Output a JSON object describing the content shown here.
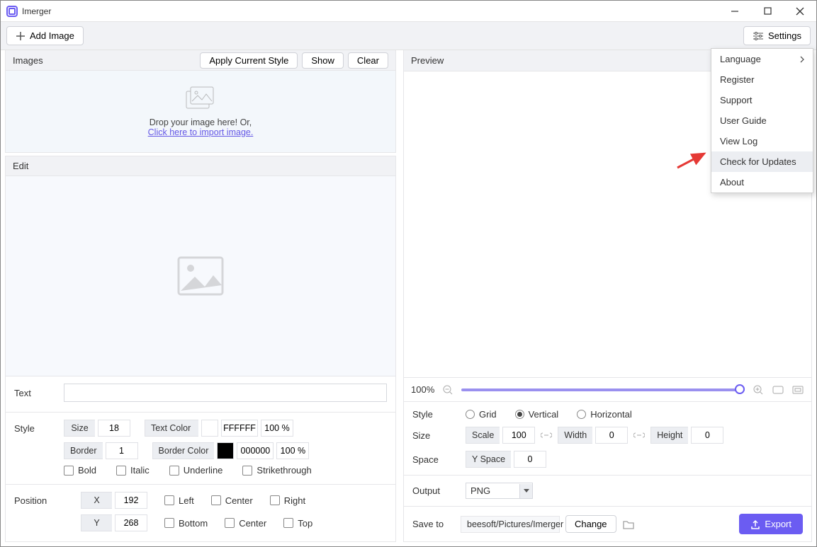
{
  "app": {
    "title": "Imerger"
  },
  "toolbar": {
    "add_image": "Add Image",
    "settings": "Settings"
  },
  "images_panel": {
    "title": "Images",
    "apply_style": "Apply Current Style",
    "show": "Show",
    "clear": "Clear",
    "drop_text": "Drop your image here! Or,",
    "drop_link": "Click here to import image."
  },
  "edit_panel": {
    "title": "Edit"
  },
  "text_section": {
    "label": "Text",
    "value": ""
  },
  "style_section": {
    "label": "Style",
    "size_label": "Size",
    "size_value": "18",
    "border_label": "Border",
    "border_value": "1",
    "text_color_label": "Text Color",
    "text_color_value": "FFFFFF",
    "text_color_opacity": "100 %",
    "border_color_label": "Border Color",
    "border_color_value": "000000",
    "border_color_opacity": "100 %",
    "bold": "Bold",
    "italic": "Italic",
    "underline": "Underline",
    "strike": "Strikethrough"
  },
  "position_section": {
    "label": "Position",
    "x_label": "X",
    "x_value": "192",
    "y_label": "Y",
    "y_value": "268",
    "left": "Left",
    "center": "Center",
    "right": "Right",
    "bottom": "Bottom",
    "top": "Top"
  },
  "preview_panel": {
    "title": "Preview"
  },
  "zoom": {
    "value": "100%"
  },
  "right_style": {
    "label": "Style",
    "grid": "Grid",
    "vertical": "Vertical",
    "horizontal": "Horizontal"
  },
  "right_size": {
    "label": "Size",
    "space_label": "Space",
    "scale_label": "Scale",
    "scale_value": "100",
    "width_label": "Width",
    "width_value": "0",
    "height_label": "Height",
    "height_value": "0",
    "yspace_label": "Y Space",
    "yspace_value": "0"
  },
  "output": {
    "label": "Output",
    "format": "PNG"
  },
  "save": {
    "label": "Save to",
    "path": "beesoft/Pictures/Imerger",
    "change": "Change",
    "export": "Export"
  },
  "settings_menu": {
    "language": "Language",
    "register": "Register",
    "support": "Support",
    "user_guide": "User Guide",
    "view_log": "View Log",
    "check_updates": "Check for Updates",
    "about": "About"
  }
}
